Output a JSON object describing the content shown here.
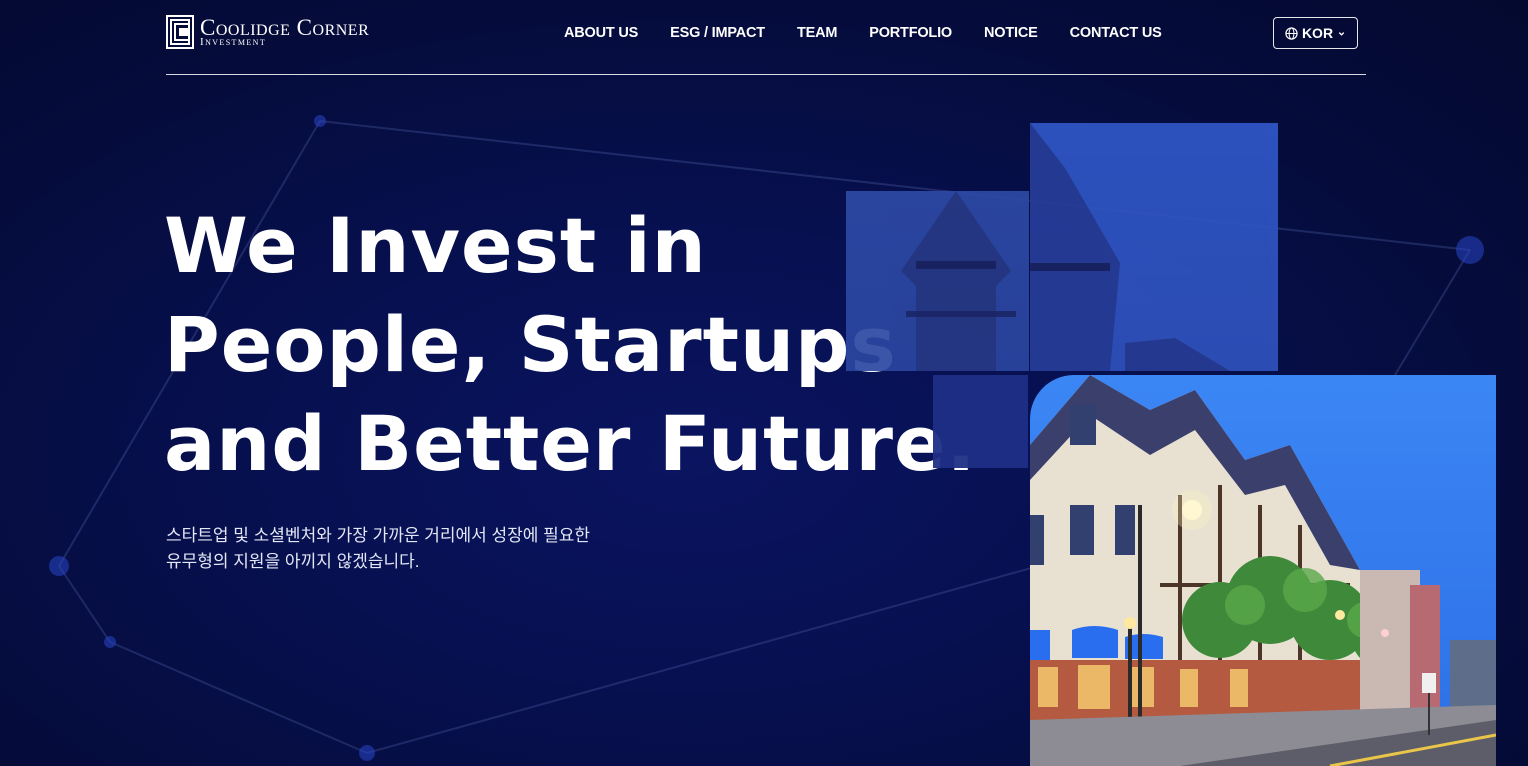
{
  "brand": {
    "name": "Coolidge Corner",
    "sub": "Investment"
  },
  "nav": {
    "items": [
      "ABOUT US",
      "ESG / IMPACT",
      "TEAM",
      "PORTFOLIO",
      "NOTICE",
      "CONTACT US"
    ]
  },
  "lang": {
    "icon": "globe-icon",
    "label": "KOR",
    "chevron": "chevron-down-icon"
  },
  "hero": {
    "headline": [
      "We Invest in",
      "People, Startups",
      "and Better Future."
    ],
    "sub": [
      "스타트업 및 소셜벤처와 가장 가까운 거리에서 성장에 필요한",
      "유무형의 지원을 아끼지 않겠습니다."
    ]
  },
  "colors": {
    "background": "#050c3c",
    "accent_blue": "#2f55c4",
    "text": "#ffffff"
  }
}
